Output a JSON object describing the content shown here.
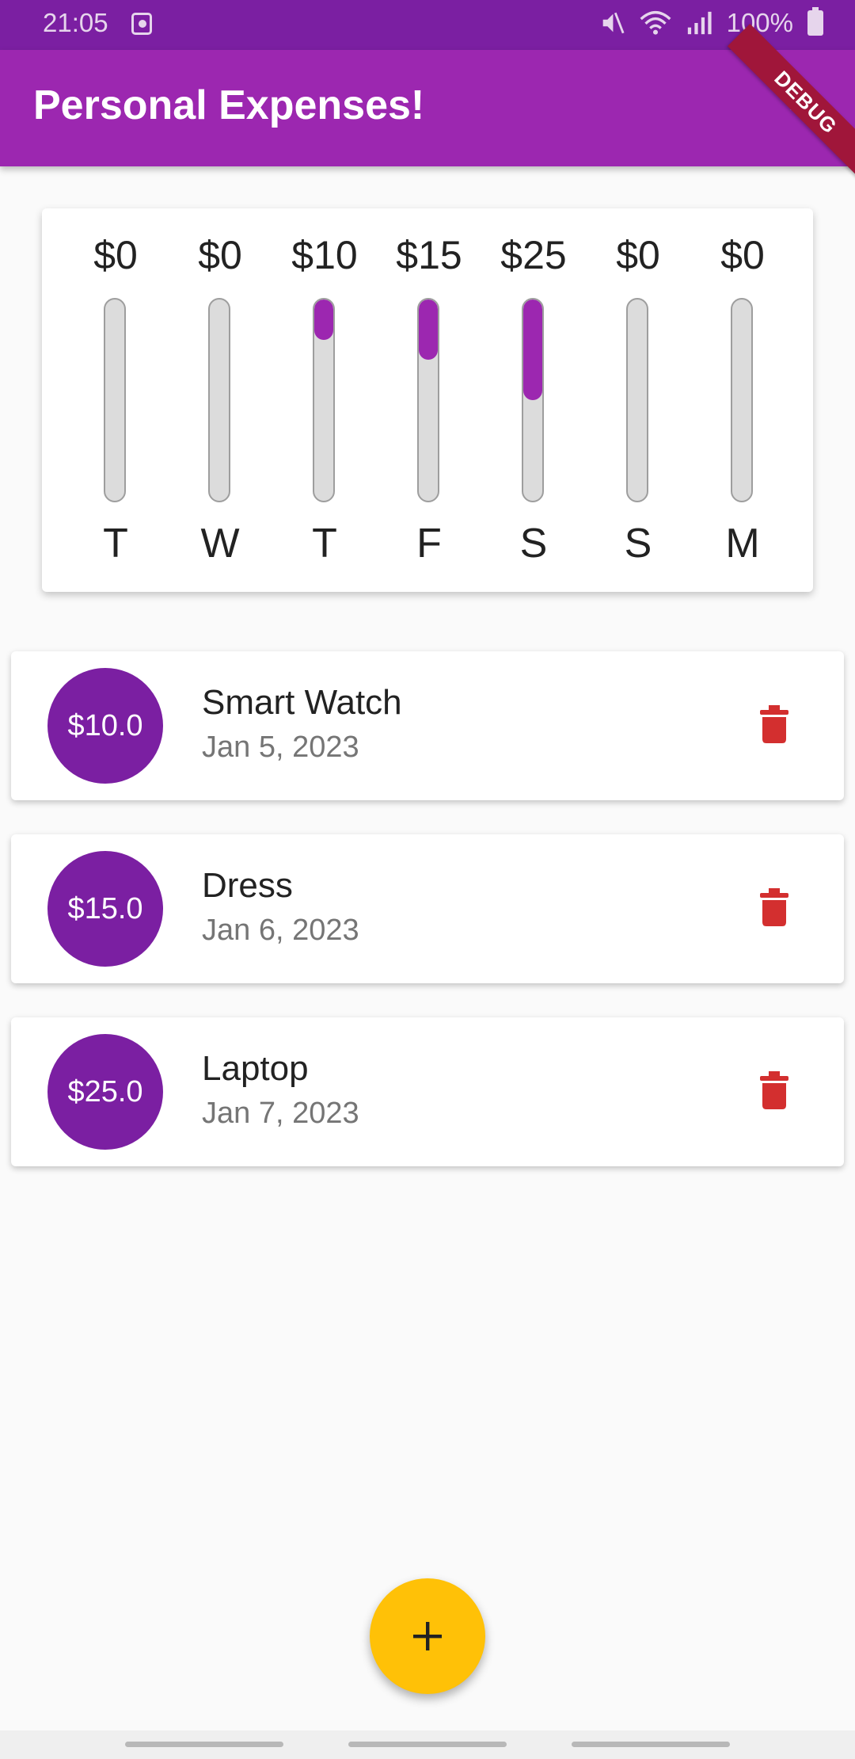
{
  "status_bar": {
    "time": "21:05",
    "battery": "100%",
    "icons": [
      "alarm-icon",
      "mute-icon",
      "wifi-icon",
      "signal-icon",
      "battery-icon"
    ]
  },
  "app_bar": {
    "title": "Personal Expenses!",
    "add_icon": "plus-icon",
    "debug_banner": "DEBUG",
    "color": "#9c27b0"
  },
  "chart": {
    "days": [
      {
        "label": "T",
        "amount": "$0",
        "fraction": 0.0
      },
      {
        "label": "W",
        "amount": "$0",
        "fraction": 0.0
      },
      {
        "label": "T",
        "amount": "$10",
        "fraction": 0.2
      },
      {
        "label": "F",
        "amount": "$15",
        "fraction": 0.3
      },
      {
        "label": "S",
        "amount": "$25",
        "fraction": 0.5
      },
      {
        "label": "S",
        "amount": "$0",
        "fraction": 0.0
      },
      {
        "label": "M",
        "amount": "$0",
        "fraction": 0.0
      }
    ]
  },
  "transactions": [
    {
      "amount": "$10.0",
      "title": "Smart Watch",
      "date": "Jan 5, 2023",
      "delete_icon": "trash-icon"
    },
    {
      "amount": "$15.0",
      "title": "Dress",
      "date": "Jan 6, 2023",
      "delete_icon": "trash-icon"
    },
    {
      "amount": "$25.0",
      "title": "Laptop",
      "date": "Jan 7, 2023",
      "delete_icon": "trash-icon"
    }
  ],
  "fab": {
    "icon": "plus-icon",
    "color": "#ffc107"
  },
  "colors": {
    "primary": "#9c27b0",
    "avatar": "#7b1fa2",
    "delete": "#d32f2f"
  }
}
